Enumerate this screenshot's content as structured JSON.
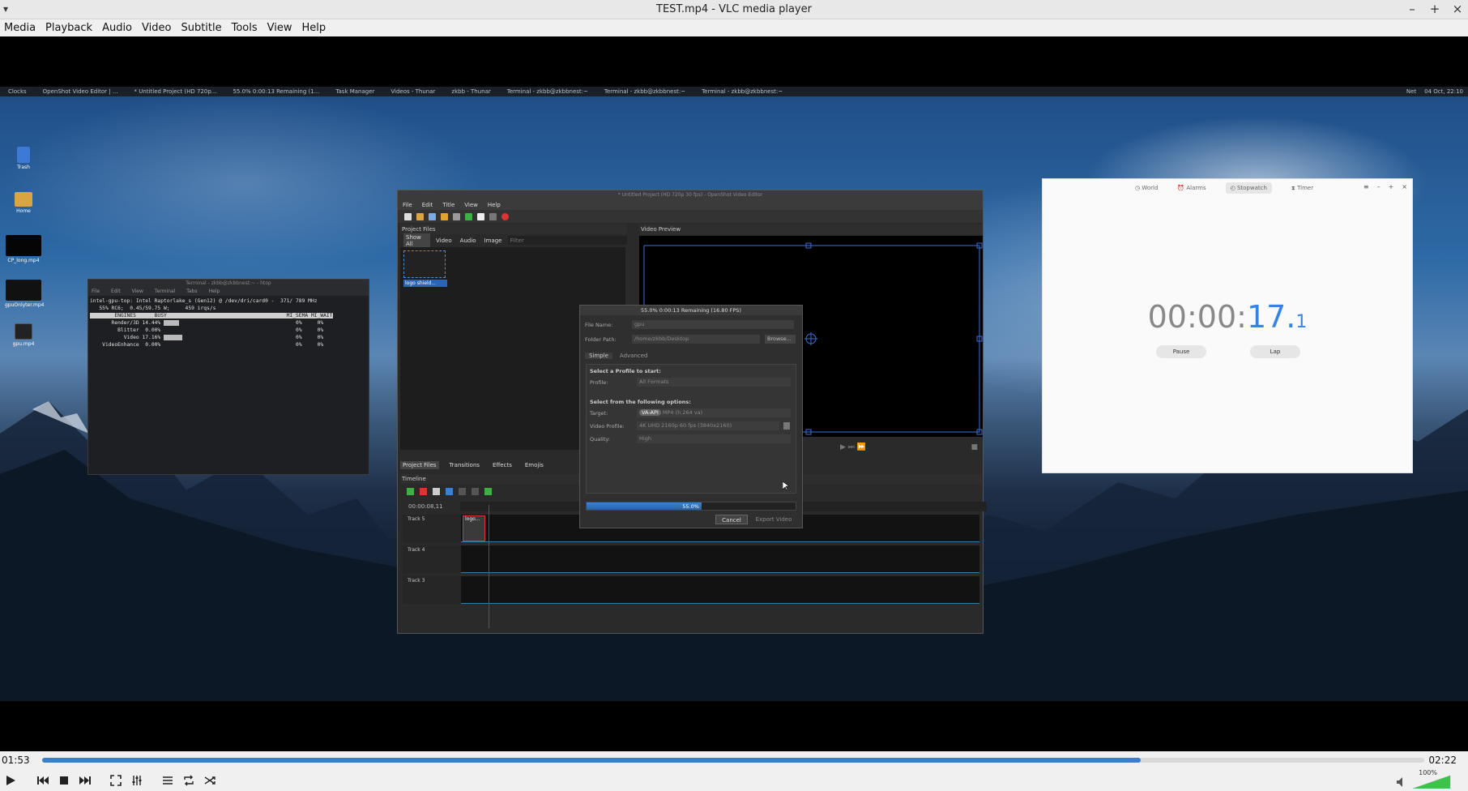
{
  "window": {
    "title": "TEST.mp4 - VLC media player"
  },
  "menu": [
    "Media",
    "Playback",
    "Audio",
    "Video",
    "Subtitle",
    "Tools",
    "View",
    "Help"
  ],
  "panel": {
    "tasks": [
      "Clocks",
      "OpenShot Video Editor | ...",
      "* Untitled Project (HD 720p...",
      "55.0% 0:00:13 Remaining (1...",
      "Task Manager",
      "Videos - Thunar",
      "zkbb - Thunar",
      "Terminal - zkbb@zkbbnest:~",
      "Terminal - zkbb@zkbbnest:~",
      "Terminal - zkbb@zkbbnest:~"
    ],
    "date": "04 Oct, 22:10",
    "misc": "Net"
  },
  "desktop_icons": [
    "Trash",
    "Home",
    "CP_long.mp4",
    "gpuOnlyter.mp4",
    "gpu.mp4"
  ],
  "terminal": {
    "title": "Terminal - zkbb@zkbbnest:~ - htop",
    "menu": [
      "File",
      "Edit",
      "View",
      "Terminal",
      "Tabs",
      "Help"
    ],
    "line1": "intel-gpu-top: Intel Raptorlake_s (Gen12) @ /dev/dri/card0 -  371/ 789 MHz",
    "line2": "   55% RC6;  0.45/59.75 W;     459 irqs/s",
    "header": "        ENGINES      BUSY                                       MI_SEMA MI_WAIT",
    "engines": [
      {
        "name": "       Render/3D",
        "busy": "14.44%",
        "sema": "0%",
        "wait": "0%"
      },
      {
        "name": "         Blitter",
        "busy": " 0.00%",
        "sema": "0%",
        "wait": "0%"
      },
      {
        "name": "           Video",
        "busy": "17.16%",
        "sema": "0%",
        "wait": "0%"
      },
      {
        "name": "    VideoEnhance",
        "busy": " 0.00%",
        "sema": "0%",
        "wait": "0%"
      }
    ]
  },
  "openshot": {
    "title": "* Untitled Project (HD 720p 30 fps) - OpenShot Video Editor",
    "menu": [
      "File",
      "Edit",
      "Title",
      "View",
      "Help"
    ],
    "project_files_label": "Project Files",
    "filter_tabs": [
      "Show All",
      "Video",
      "Audio",
      "Image"
    ],
    "filter_placeholder": "Filter",
    "file_name": "logo shield...",
    "video_preview_label": "Video Preview",
    "bottom_tabs": [
      "Project Files",
      "Transitions",
      "Effects",
      "Emojis"
    ],
    "timeline_label": "Timeline",
    "timecode": "00:00:08,11",
    "tracks": [
      "Track 5",
      "Track 4",
      "Track 3"
    ],
    "clip_label": "logo..."
  },
  "export_dialog": {
    "title": "55.0%  0:00:13 Remaining (16.80 FPS)",
    "file_name_label": "File Name:",
    "file_name_value": "gpu",
    "folder_label": "Folder Path:",
    "folder_value": "/home/zkbb/Desktop",
    "browse_label": "Browse...",
    "tabs": [
      "Simple",
      "Advanced"
    ],
    "profile_heading": "Select a Profile to start:",
    "profile_label": "Profile:",
    "profile_value": "All Formats",
    "options_heading": "Select from the following options:",
    "target_label": "Target:",
    "target_badge": "VA-API",
    "target_value": "MP4 (h.264 va)",
    "video_profile_label": "Video Profile:",
    "video_profile_value": "4K UHD 2160p 60 fps (3840x2160)",
    "quality_label": "Quality:",
    "quality_value": "High",
    "progress": 0.55,
    "progress_label": "55.0%",
    "cancel_label": "Cancel",
    "export_label": "Export Video"
  },
  "clocks": {
    "tabs": [
      "World",
      "Alarms",
      "Stopwatch",
      "Timer"
    ],
    "active_tab": "Stopwatch",
    "hours": "00",
    "minutes": "00",
    "seconds": "17",
    "tenths": "1",
    "pause_label": "Pause",
    "lap_label": "Lap"
  },
  "player": {
    "elapsed": "01:53",
    "total": "02:22",
    "position": 0.795,
    "volume_label": "100%",
    "volume": 1.0,
    "accent": "#3b7ec9"
  }
}
